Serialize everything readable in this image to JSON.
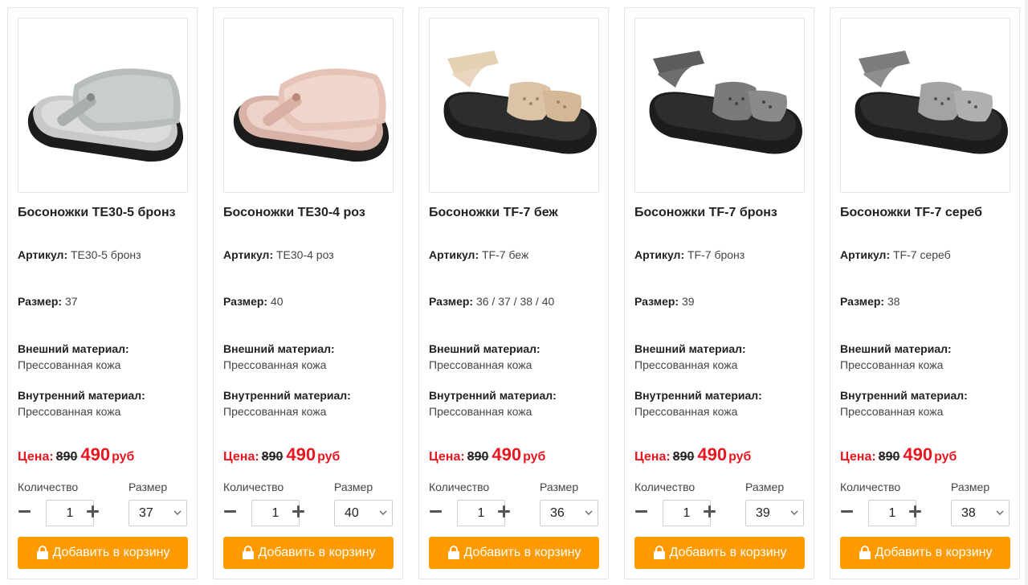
{
  "labels": {
    "sku": "Артикул:",
    "size": "Размер:",
    "outer": "Внешний материал:",
    "inner": "Внутренний материал:",
    "price": "Цена:",
    "currency": "руб",
    "qty": "Количество",
    "size_select": "Размер",
    "add_to_cart": "Добавить в корзину"
  },
  "colors": {
    "price": "#e8161e",
    "button": "#ff9a00"
  },
  "products": [
    {
      "name": "Босоножки TE30-5 бронз",
      "sku": "TE30-5 бронз",
      "sizes": "37",
      "outer": "Прессованная кожа",
      "inner": "Прессованная кожа",
      "old_price": "890",
      "new_price": "490",
      "qty": "1",
      "selected_size": "37",
      "image": "silver-slide-sandal"
    },
    {
      "name": "Босоножки TE30-4 роз",
      "sku": "TE30-4 роз",
      "sizes": "40",
      "outer": "Прессованная кожа",
      "inner": "Прессованная кожа",
      "old_price": "890",
      "new_price": "490",
      "qty": "1",
      "selected_size": "40",
      "image": "pink-slide-sandal"
    },
    {
      "name": "Босоножки TF-7 беж",
      "sku": "TF-7 беж",
      "sizes": "36 / 37 / 38 / 40",
      "outer": "Прессованная кожа",
      "inner": "Прессованная кожа",
      "old_price": "890",
      "new_price": "490",
      "qty": "1",
      "selected_size": "36",
      "image": "beige-strap-sandal"
    },
    {
      "name": "Босоножки TF-7 бронз",
      "sku": "TF-7 бронз",
      "sizes": "39",
      "outer": "Прессованная кожа",
      "inner": "Прессованная кожа",
      "old_price": "890",
      "new_price": "490",
      "qty": "1",
      "selected_size": "39",
      "image": "bronze-strap-sandal"
    },
    {
      "name": "Босоножки TF-7 сереб",
      "sku": "TF-7 сереб",
      "sizes": "38",
      "outer": "Прессованная кожа",
      "inner": "Прессованная кожа",
      "old_price": "890",
      "new_price": "490",
      "qty": "1",
      "selected_size": "38",
      "image": "silver-strap-sandal"
    }
  ]
}
